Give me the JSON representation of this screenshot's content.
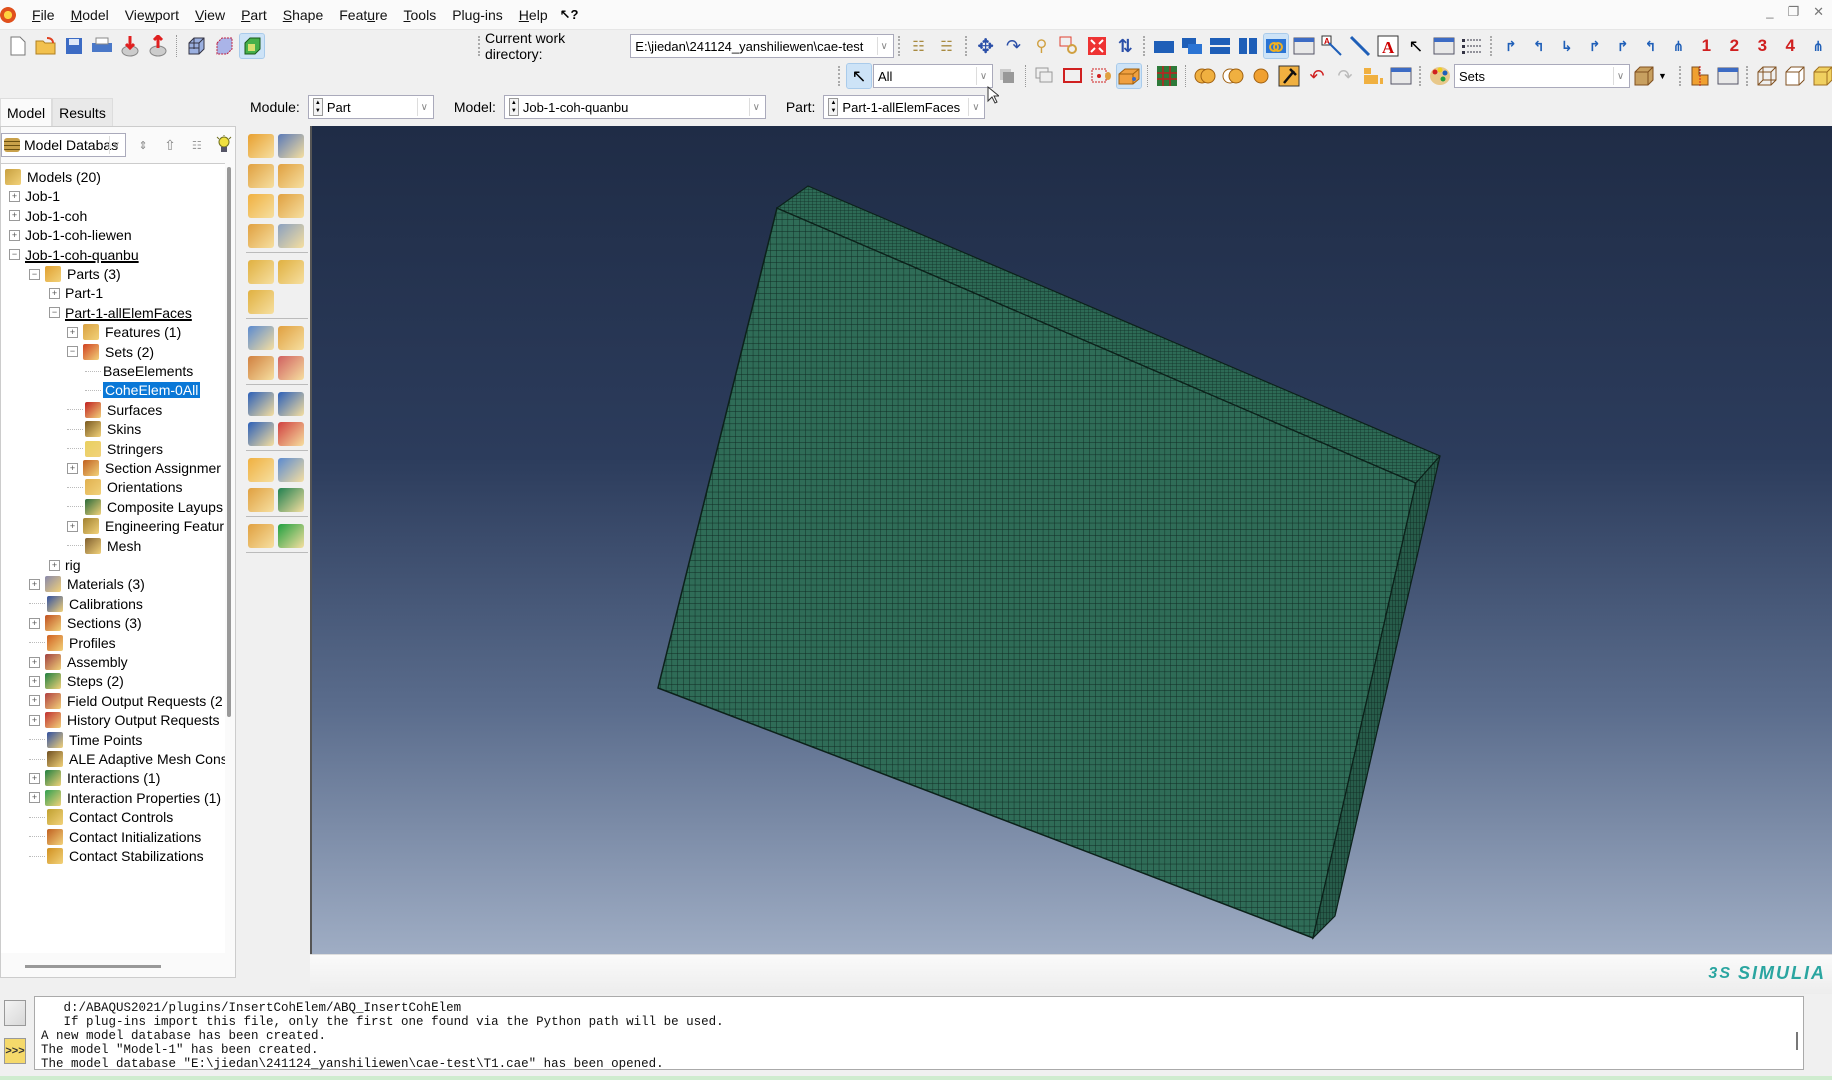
{
  "menubar": {
    "items": [
      {
        "label": "File",
        "u": "F"
      },
      {
        "label": "Model",
        "u": "M"
      },
      {
        "label": "Viewport",
        "u": "w"
      },
      {
        "label": "View",
        "u": "V"
      },
      {
        "label": "Part",
        "u": "P"
      },
      {
        "label": "Shape",
        "u": "S"
      },
      {
        "label": "Feature",
        "u": "u"
      },
      {
        "label": "Tools",
        "u": "T"
      },
      {
        "label": "Plug-ins",
        "u": "g"
      },
      {
        "label": "Help",
        "u": "H"
      }
    ],
    "whats_this": "↖?",
    "window_controls": [
      "_",
      "❐",
      "✕"
    ]
  },
  "toolbar": {
    "cwd_label": "Current work directory:",
    "cwd_value": "E:\\jiedan\\241124_yanshiliewen\\cae-test",
    "selection_filter": "All",
    "color_code": "Sets",
    "view_numbers": [
      "1",
      "2",
      "3",
      "4"
    ]
  },
  "context": {
    "module_label": "Module:",
    "module_value": "Part",
    "model_label": "Model:",
    "model_value": "Job-1-coh-quanbu",
    "part_label": "Part:",
    "part_value": "Part-1-allElemFaces"
  },
  "tabs": {
    "model": "Model",
    "results": "Results"
  },
  "tree": {
    "db_selector": "Model Databas",
    "rows": [
      {
        "label": "Models (20)",
        "level": 0,
        "exp": "",
        "icon": "models"
      },
      {
        "label": "Job-1",
        "level": 1,
        "exp": "+",
        "icon": ""
      },
      {
        "label": "Job-1-coh",
        "level": 1,
        "exp": "+",
        "icon": ""
      },
      {
        "label": "Job-1-coh-liewen",
        "level": 1,
        "exp": "+",
        "icon": ""
      },
      {
        "label": "Job-1-coh-quanbu",
        "level": 1,
        "exp": "-",
        "icon": "",
        "underline": true
      },
      {
        "label": "Parts (3)",
        "level": 2,
        "exp": "-",
        "icon": "parts"
      },
      {
        "label": "Part-1",
        "level": 3,
        "exp": "+",
        "icon": ""
      },
      {
        "label": "Part-1-allElemFaces",
        "level": 3,
        "exp": "-",
        "icon": "",
        "underline": true
      },
      {
        "label": "Features (1)",
        "level": 4,
        "exp": "+",
        "icon": "features"
      },
      {
        "label": "Sets (2)",
        "level": 4,
        "exp": "-",
        "icon": "sets"
      },
      {
        "label": "BaseElements",
        "level": 5,
        "exp": "",
        "icon": ""
      },
      {
        "label": "CoheElem-0All",
        "level": 5,
        "exp": "",
        "icon": "",
        "selected": true
      },
      {
        "label": "Surfaces",
        "level": 4,
        "exp": "",
        "icon": "surfaces"
      },
      {
        "label": "Skins",
        "level": 4,
        "exp": "",
        "icon": "skins"
      },
      {
        "label": "Stringers",
        "level": 4,
        "exp": "",
        "icon": "stringers"
      },
      {
        "label": "Section Assignmer",
        "level": 4,
        "exp": "+",
        "icon": "section-assignments"
      },
      {
        "label": "Orientations",
        "level": 4,
        "exp": "",
        "icon": "orientations"
      },
      {
        "label": "Composite Layups",
        "level": 4,
        "exp": "",
        "icon": "composite-layups"
      },
      {
        "label": "Engineering Featur",
        "level": 4,
        "exp": "+",
        "icon": "engineering-features"
      },
      {
        "label": "Mesh",
        "level": 4,
        "exp": "",
        "icon": "mesh"
      },
      {
        "label": "rig",
        "level": 3,
        "exp": "+",
        "icon": ""
      },
      {
        "label": "Materials (3)",
        "level": 2,
        "exp": "+",
        "icon": "materials"
      },
      {
        "label": "Calibrations",
        "level": 2,
        "exp": "",
        "icon": "calibrations"
      },
      {
        "label": "Sections (3)",
        "level": 2,
        "exp": "+",
        "icon": "sections"
      },
      {
        "label": "Profiles",
        "level": 2,
        "exp": "",
        "icon": "profiles"
      },
      {
        "label": "Assembly",
        "level": 2,
        "exp": "+",
        "icon": "assembly"
      },
      {
        "label": "Steps (2)",
        "level": 2,
        "exp": "+",
        "icon": "steps"
      },
      {
        "label": "Field Output Requests (2",
        "level": 2,
        "exp": "+",
        "icon": "field-output"
      },
      {
        "label": "History Output Requests",
        "level": 2,
        "exp": "+",
        "icon": "history-output"
      },
      {
        "label": "Time Points",
        "level": 2,
        "exp": "",
        "icon": "time-points"
      },
      {
        "label": "ALE Adaptive Mesh Cons",
        "level": 2,
        "exp": "",
        "icon": "ale-mesh"
      },
      {
        "label": "Interactions (1)",
        "level": 2,
        "exp": "+",
        "icon": "interactions"
      },
      {
        "label": "Interaction Properties (1)",
        "level": 2,
        "exp": "+",
        "icon": "interaction-properties"
      },
      {
        "label": "Contact Controls",
        "level": 2,
        "exp": "",
        "icon": "contact-controls"
      },
      {
        "label": "Contact Initializations",
        "level": 2,
        "exp": "",
        "icon": "contact-initializations"
      },
      {
        "label": "Contact Stabilizations",
        "level": 2,
        "exp": "",
        "icon": "contact-stabilizations"
      }
    ]
  },
  "viewport": {
    "brand": "SIMULIA",
    "mesh_color": "#2e6a56",
    "bg_top": "#1f2c46",
    "bg_bottom": "#9fadc4"
  },
  "messages": {
    "lines": [
      "   d:/ABAQUS2021/plugins/InsertCohElem/ABQ_InsertCohElem",
      "   If plug-ins import this file, only the first one found via the Python path will be used.",
      "A new model database has been created.",
      "The model \"Model-1\" has been created.",
      "The model database \"E:\\jiedan\\241124_yanshiliewen\\cae-test\\T1.cae\" has been opened."
    ],
    "cmd_button": ">>>"
  }
}
